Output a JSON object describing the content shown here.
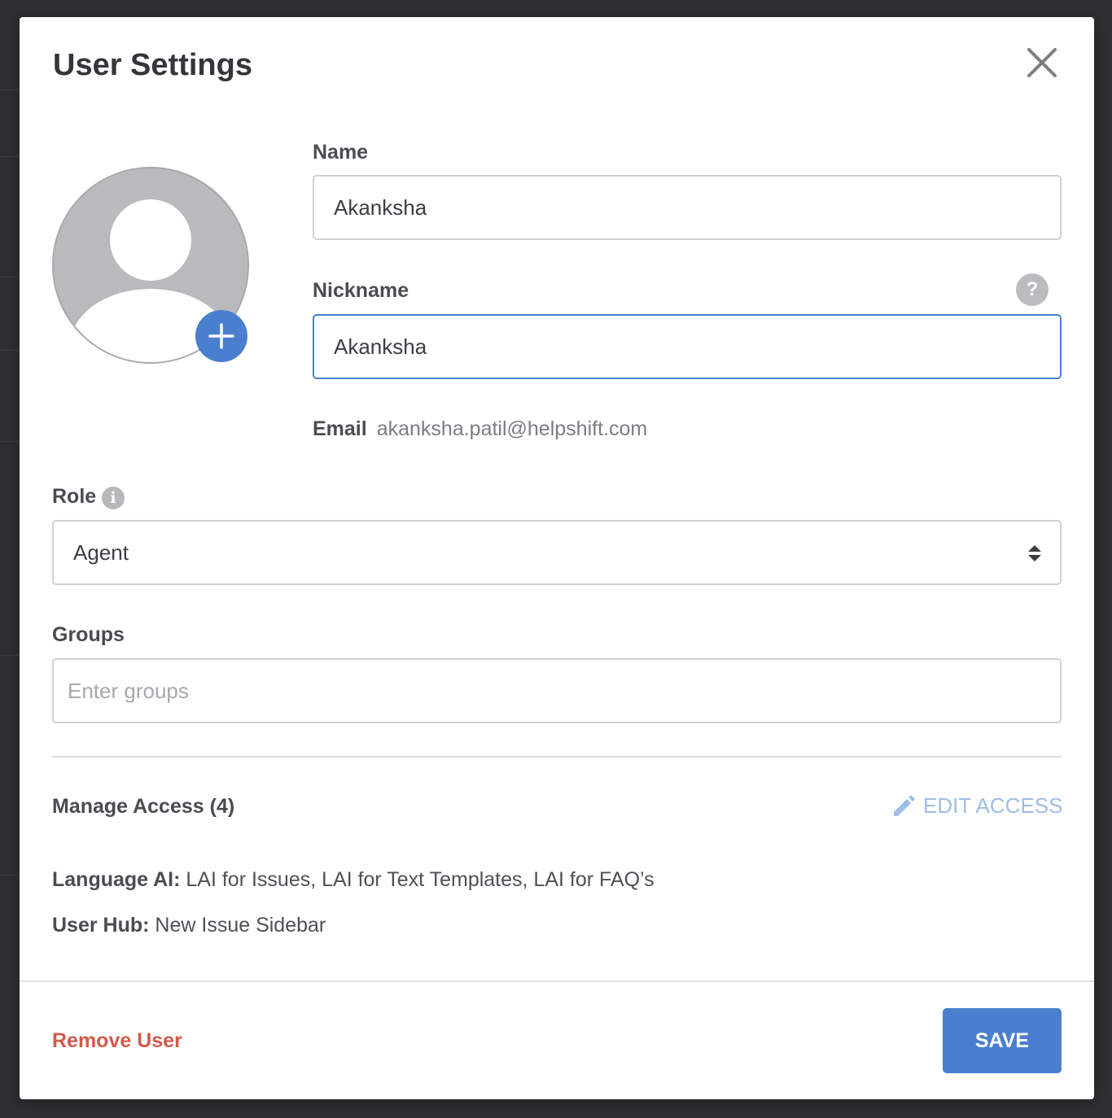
{
  "modal": {
    "title": "User Settings",
    "close_icon": "close-icon"
  },
  "avatar": {
    "add_icon": "plus-icon"
  },
  "name": {
    "label": "Name",
    "value": "Akanksha"
  },
  "nickname": {
    "label": "Nickname",
    "value": "Akanksha",
    "help_glyph": "?"
  },
  "email": {
    "label": "Email",
    "value": "akanksha.patil@helpshift.com"
  },
  "role": {
    "label": "Role",
    "info_glyph": "i",
    "selected": "Agent"
  },
  "groups": {
    "label": "Groups",
    "placeholder": "Enter groups",
    "value": ""
  },
  "access": {
    "title": "Manage Access (4)",
    "edit_label": "EDIT ACCESS",
    "items": [
      {
        "label": "Language AI:",
        "value": "LAI for Issues, LAI for Text Templates, LAI for FAQ’s"
      },
      {
        "label": "User Hub:",
        "value": "New Issue Sidebar"
      }
    ]
  },
  "footer": {
    "remove_label": "Remove User",
    "save_label": "SAVE"
  },
  "colors": {
    "accent": "#4a7fd0",
    "danger": "#d25a4b",
    "edit_link": "#9fbde6"
  }
}
